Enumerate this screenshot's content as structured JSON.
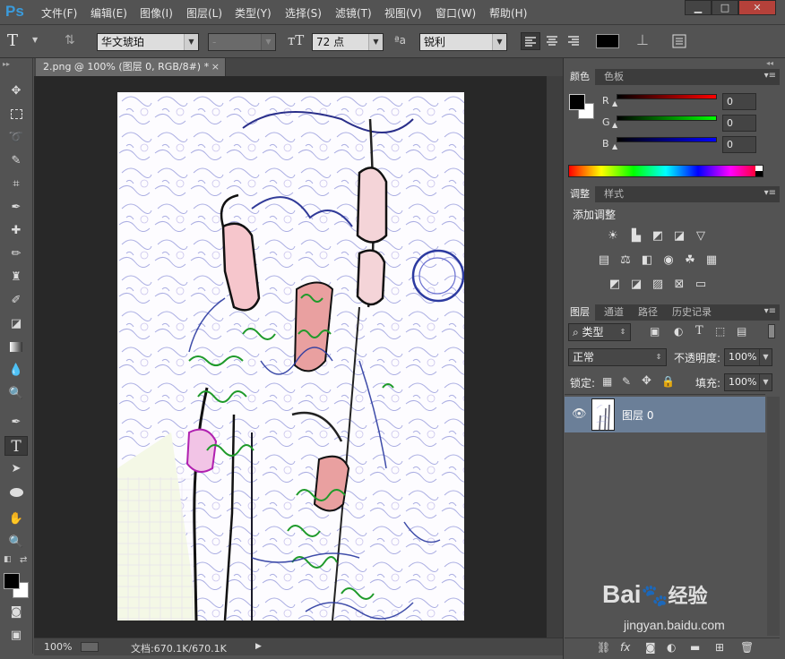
{
  "app": {
    "logo": "Ps"
  },
  "menu": [
    "文件(F)",
    "编辑(E)",
    "图像(I)",
    "图层(L)",
    "类型(Y)",
    "选择(S)",
    "滤镜(T)",
    "视图(V)",
    "窗口(W)",
    "帮助(H)"
  ],
  "window_controls": {
    "minimize": "▁",
    "maximize": "□",
    "close": "✕"
  },
  "options": {
    "font_family": "华文琥珀",
    "font_style": "-",
    "font_size": "72 点",
    "aa_label": "ªa",
    "antialias": "锐利",
    "color": "#000000"
  },
  "document": {
    "tab_title": "2.png @ 100% (图层 0, RGB/8#) *",
    "tab_close": "×"
  },
  "status": {
    "zoom": "100%",
    "doc_info": "文档:670.1K/670.1K"
  },
  "color_panel": {
    "tabs": [
      "颜色",
      "色板"
    ],
    "channels": [
      {
        "label": "R",
        "value": "0",
        "gradient_to": "#ff0000"
      },
      {
        "label": "G",
        "value": "0",
        "gradient_to": "#00ff00"
      },
      {
        "label": "B",
        "value": "0",
        "gradient_to": "#0000ff"
      }
    ]
  },
  "adjust_panel": {
    "tabs": [
      "调整",
      "样式"
    ],
    "title": "添加调整"
  },
  "layers_panel": {
    "tabs": [
      "图层",
      "通道",
      "路径",
      "历史记录"
    ],
    "filter_type": "类型",
    "blend_mode": "正常",
    "opacity_label": "不透明度:",
    "opacity": "100%",
    "lock_label": "锁定:",
    "fill_label": "填充:",
    "fill": "100%",
    "layer_name": "图层 0"
  },
  "watermark": {
    "brand": "Bai",
    "brand_tail": "经验",
    "url": "jingyan.baidu.com"
  },
  "colors": {
    "accent_blue": "#3a9bdc",
    "layer_selected": "#6b7f98"
  }
}
